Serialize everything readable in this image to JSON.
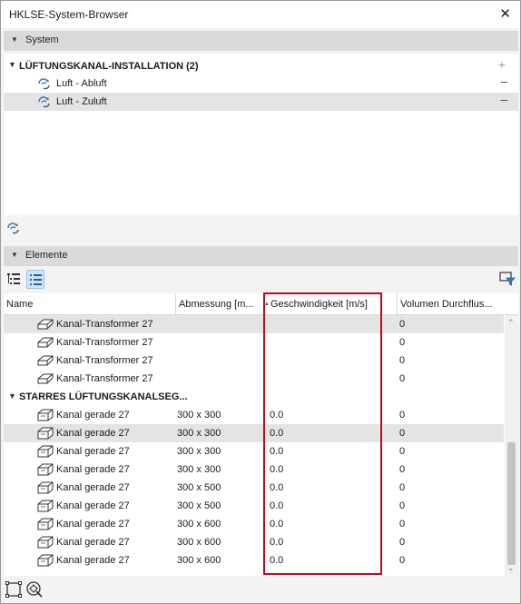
{
  "window": {
    "title": "HKLSE-System-Browser",
    "close_icon": "close-icon"
  },
  "system_section": {
    "header": "System",
    "group": {
      "label": "LÜFTUNGSKANAL-INSTALLATION (2)",
      "action": "+"
    },
    "items": [
      {
        "label": "Luft - Abluft",
        "action": "–",
        "selected": false
      },
      {
        "label": "Luft - Zuluft",
        "action": "–",
        "selected": true
      }
    ]
  },
  "elements_section": {
    "header": "Elemente",
    "columns": [
      "Name",
      "Abmessung [m...",
      "Geschwindigkeit [m/s]",
      "Volumen Durchflus..."
    ],
    "rows": [
      {
        "type": "item",
        "icon": "transformer-duct-icon",
        "name": "Kanal-Transformer 27",
        "abmessung": "",
        "geschw": "",
        "volumen": "0",
        "selected": true
      },
      {
        "type": "item",
        "icon": "transformer-duct-icon",
        "name": "Kanal-Transformer 27",
        "abmessung": "",
        "geschw": "",
        "volumen": "0"
      },
      {
        "type": "item",
        "icon": "transformer-duct-icon",
        "name": "Kanal-Transformer 27",
        "abmessung": "",
        "geschw": "",
        "volumen": "0"
      },
      {
        "type": "item",
        "icon": "transformer-duct-icon",
        "name": "Kanal-Transformer 27",
        "abmessung": "",
        "geschw": "",
        "volumen": "0"
      },
      {
        "type": "group",
        "name": "STARRES LÜFTUNGSKANALSEG..."
      },
      {
        "type": "item",
        "icon": "straight-duct-icon",
        "name": "Kanal gerade 27",
        "abmessung": "300 x 300",
        "geschw": "0.0",
        "volumen": "0"
      },
      {
        "type": "item",
        "icon": "straight-duct-icon",
        "name": "Kanal gerade 27",
        "abmessung": "300 x 300",
        "geschw": "0.0",
        "volumen": "0",
        "selected": true
      },
      {
        "type": "item",
        "icon": "straight-duct-icon",
        "name": "Kanal gerade 27",
        "abmessung": "300 x 300",
        "geschw": "0.0",
        "volumen": "0"
      },
      {
        "type": "item",
        "icon": "straight-duct-icon",
        "name": "Kanal gerade 27",
        "abmessung": "300 x 300",
        "geschw": "0.0",
        "volumen": "0"
      },
      {
        "type": "item",
        "icon": "straight-duct-icon",
        "name": "Kanal gerade 27",
        "abmessung": "300 x 500",
        "geschw": "0.0",
        "volumen": "0"
      },
      {
        "type": "item",
        "icon": "straight-duct-icon",
        "name": "Kanal gerade 27",
        "abmessung": "300 x 500",
        "geschw": "0.0",
        "volumen": "0"
      },
      {
        "type": "item",
        "icon": "straight-duct-icon",
        "name": "Kanal gerade 27",
        "abmessung": "300 x 600",
        "geschw": "0.0",
        "volumen": "0"
      },
      {
        "type": "item",
        "icon": "straight-duct-icon",
        "name": "Kanal gerade 27",
        "abmessung": "300 x 600",
        "geschw": "0.0",
        "volumen": "0"
      },
      {
        "type": "item",
        "icon": "straight-duct-icon",
        "name": "Kanal gerade 27",
        "abmessung": "300 x 600",
        "geschw": "0.0",
        "volumen": "0"
      }
    ]
  },
  "colors": {
    "highlight": "#d0021b",
    "selection": "#e4e4e4",
    "active_button": "#cfe4f7"
  }
}
